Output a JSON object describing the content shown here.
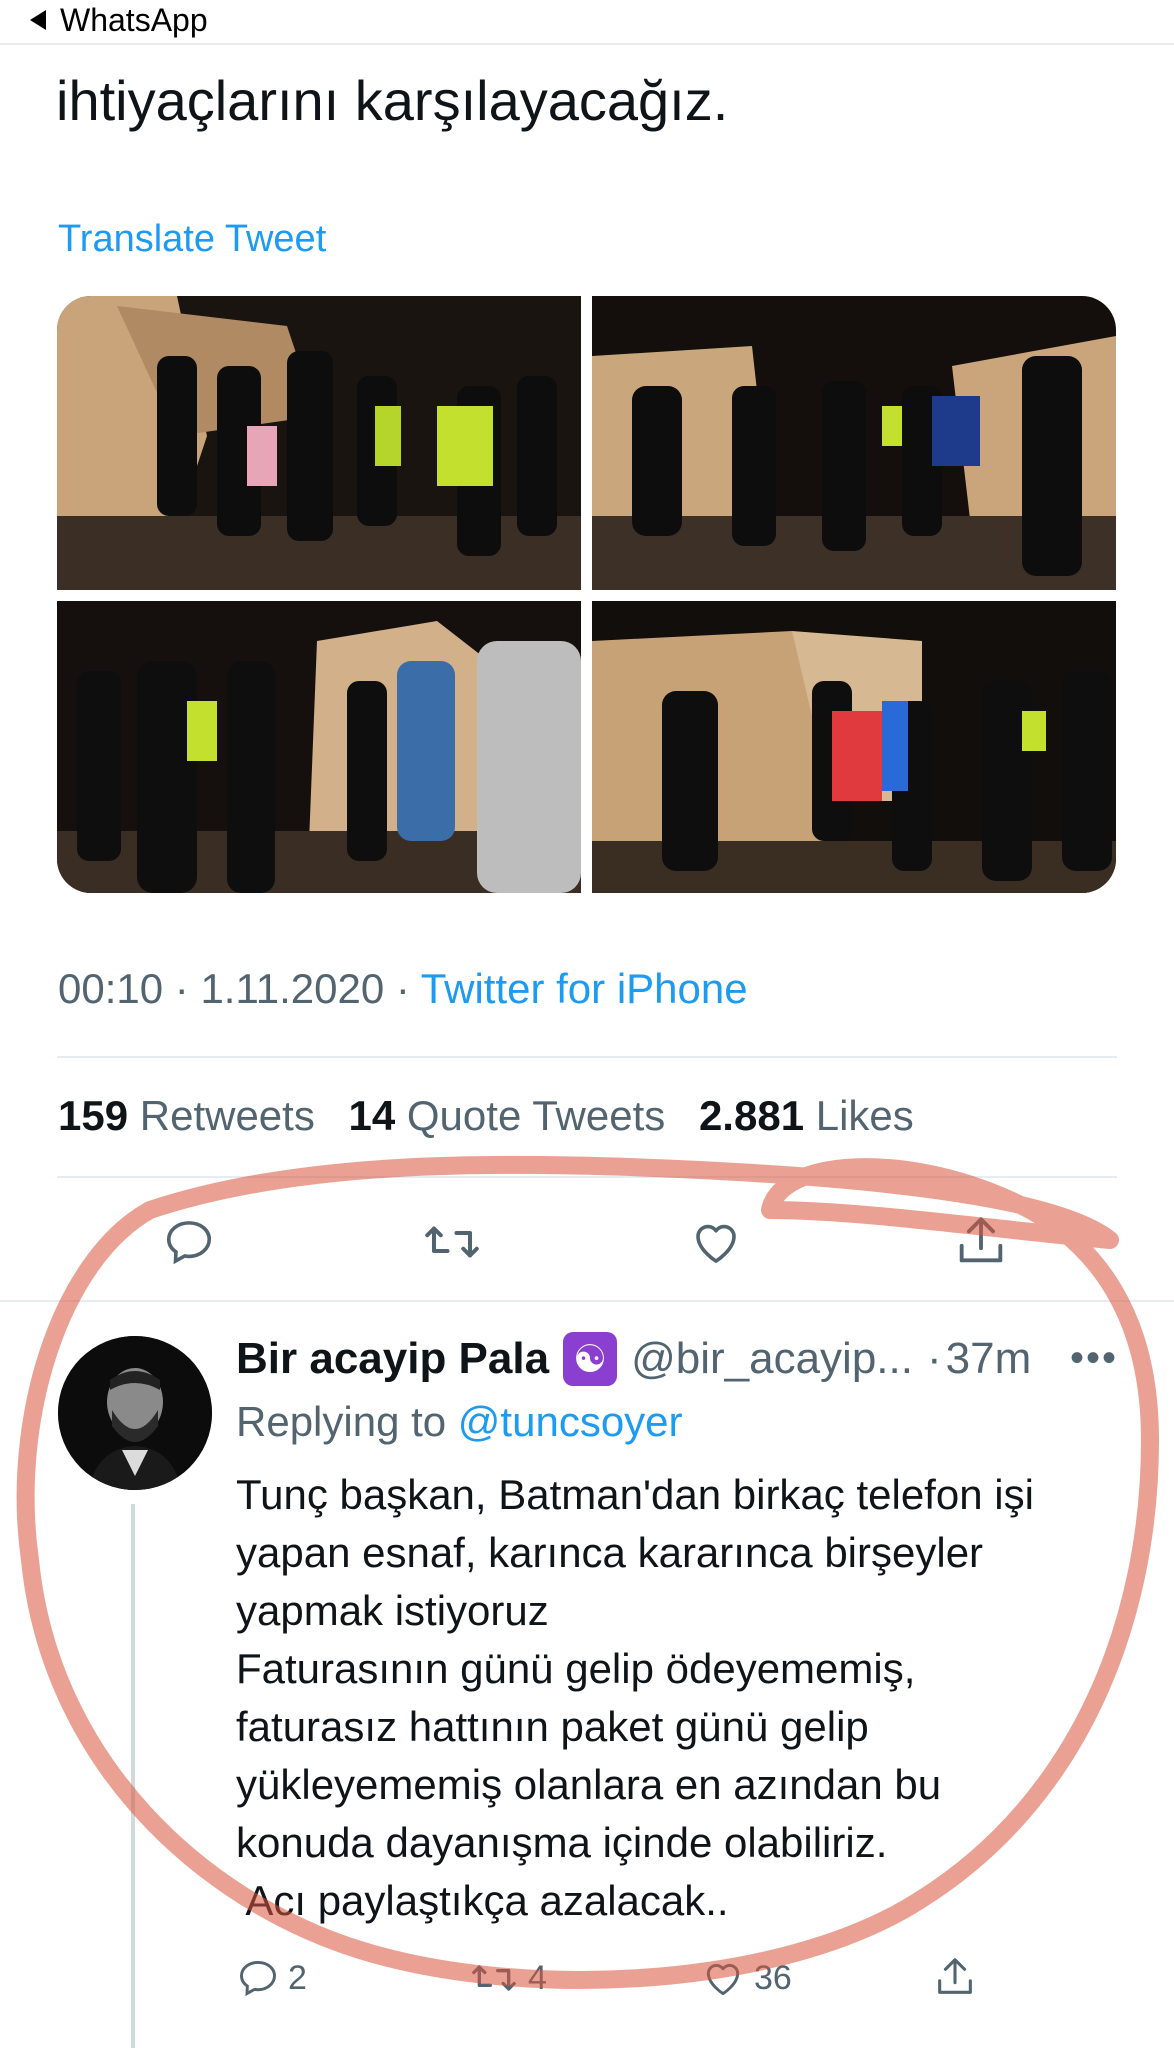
{
  "status_bar": {
    "back_label": "WhatsApp"
  },
  "tweet": {
    "text_end": "ihtiyaçlarını karşılayacağız.",
    "translate_label": "Translate Tweet",
    "time": "00:10",
    "date": "1.11.2020",
    "source": "Twitter for iPhone",
    "separator": "·",
    "stats": {
      "retweets_count": "159",
      "retweets_label": "Retweets",
      "quotes_count": "14",
      "quotes_label": "Quote Tweets",
      "likes_count": "2.881",
      "likes_label": "Likes"
    },
    "actions": [
      "reply-icon",
      "retweet-icon",
      "like-icon",
      "share-icon"
    ]
  },
  "reply": {
    "name": "Bir acayip Pala",
    "badge_icon": "yin-yang-icon",
    "badge_glyph": "☯",
    "handle": "@bir_acayip...",
    "dot": "·",
    "time": "37m",
    "more": "•••",
    "replying_prefix": "Replying to",
    "replying_to": "@tuncsoyer",
    "lines": [
      "Tunç başkan, Batman'dan birkaç telefon işi",
      "yapan esnaf, karınca kararınca birşeyler",
      "yapmak istiyoruz",
      "Faturasının günü gelip ödeyememiş,",
      "faturasız hattının paket günü gelip",
      "yükleyememiş olanlara en azından bu",
      "konuda dayanışma içinde olabiliriz.",
      " Acı paylaştıkça azalacak.."
    ],
    "reply_count": "2",
    "retweet_count": "4",
    "like_count": "36"
  },
  "colors": {
    "link": "#1d9bf0",
    "muted": "#536471",
    "annotation": "#d9533c",
    "badge": "#8a3fd1"
  }
}
